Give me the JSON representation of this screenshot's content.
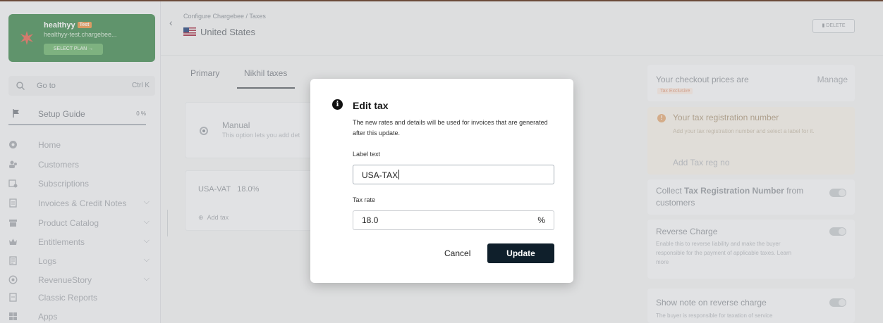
{
  "site": {
    "name": "healthyy",
    "badge": "Test",
    "url": "healthyy-test.chargebee...",
    "select_plan": "SELECT PLAN →"
  },
  "search": {
    "placeholder": "Go to",
    "shortcut": "Ctrl K"
  },
  "setup": {
    "label": "Setup Guide",
    "percent": "0 %"
  },
  "nav": [
    {
      "label": "Home",
      "icon": "home-icon",
      "chevron": false
    },
    {
      "label": "Customers",
      "icon": "customers-icon",
      "chevron": false
    },
    {
      "label": "Subscriptions",
      "icon": "subscriptions-icon",
      "chevron": false
    },
    {
      "label": "Invoices & Credit Notes",
      "icon": "invoice-icon",
      "chevron": true
    },
    {
      "label": "Product Catalog",
      "icon": "catalog-icon",
      "chevron": true
    },
    {
      "label": "Entitlements",
      "icon": "crown-icon",
      "chevron": true
    },
    {
      "label": "Logs",
      "icon": "logs-icon",
      "chevron": true
    },
    {
      "label": "RevenueStory",
      "icon": "revenuestory-icon",
      "chevron": true
    },
    {
      "label": "Classic Reports",
      "icon": "reports-icon",
      "chevron": false
    },
    {
      "label": "Apps",
      "icon": "apps-icon",
      "chevron": false
    }
  ],
  "header": {
    "breadcrumb": "Configure Chargebee / Taxes",
    "country": "United States",
    "delete_label": "DELETE"
  },
  "tabs": [
    {
      "label": "Primary",
      "active": false
    },
    {
      "label": "Nikhil taxes",
      "active": true
    }
  ],
  "manual": {
    "title": "Manual",
    "description": "This option lets you add det"
  },
  "tax_row": {
    "name": "USA-VAT",
    "rate": "18.0%",
    "add_label": "Add tax"
  },
  "right_panel": {
    "checkout_title": "Your checkout prices are",
    "manage": "Manage",
    "tax_exclusive": "Tax Exclusive",
    "reg_title": "Your tax registration number",
    "reg_desc": "Add your tax registration number and select a label for it.",
    "reg_link": "Add Tax reg no",
    "collect_prefix": "Collect ",
    "collect_bold": "Tax Registration Number",
    "collect_suffix": " from customers",
    "reverse_title": "Reverse Charge",
    "reverse_desc": "Enable this to reverse liability and make the buyer responsible for the payment of applicable taxes. Learn more",
    "note_title": "Show note on reverse charge",
    "note_desc": "The buyer is responsible for taxation of service"
  },
  "modal": {
    "title": "Edit tax",
    "description": "The new rates and details will be used for invoices that are generated after this update.",
    "label_text_label": "Label text",
    "label_text_value": "USA-TAX",
    "tax_rate_label": "Tax rate",
    "tax_rate_value": "18.0",
    "tax_rate_suffix": "%",
    "cancel": "Cancel",
    "update": "Update"
  }
}
